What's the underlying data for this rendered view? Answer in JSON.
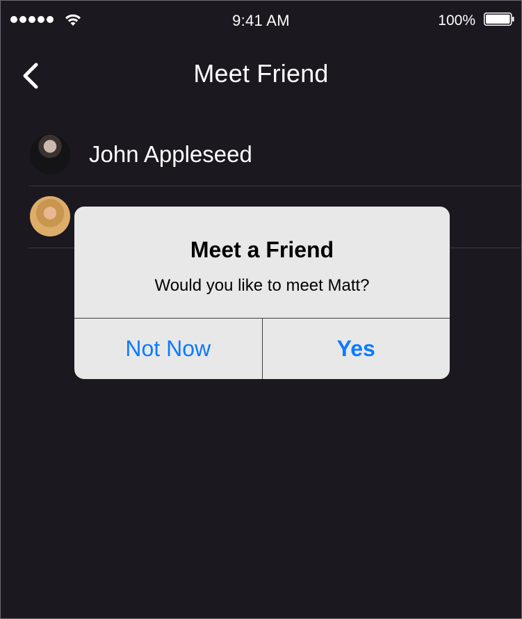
{
  "status_bar": {
    "time": "9:41 AM",
    "battery_percent": "100%",
    "signal_bars": 5,
    "icons": [
      "signal-dots-icon",
      "wifi-icon",
      "battery-icon"
    ]
  },
  "nav": {
    "title": "Meet Friend",
    "back_icon": "chevron-left-icon"
  },
  "friends": [
    {
      "name": "John Appleseed",
      "avatar": "avatar-photo"
    },
    {
      "name": "",
      "avatar": "avatar-photo"
    }
  ],
  "alert": {
    "title": "Meet a Friend",
    "message": "Would you like to meet Matt?",
    "cancel_label": "Not Now",
    "confirm_label": "Yes"
  },
  "colors": {
    "background": "#1b1820",
    "alert_background": "#e9e8e8",
    "accent": "#0b7bff",
    "text_light": "#ffffff"
  }
}
